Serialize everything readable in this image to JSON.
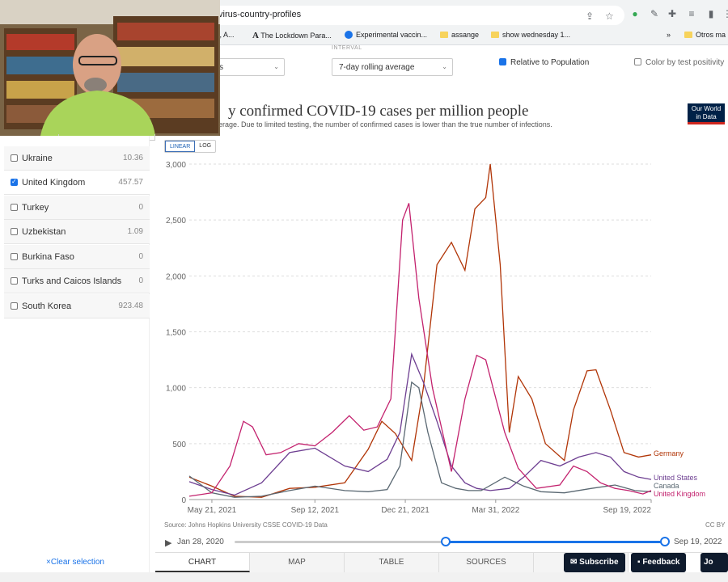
{
  "browser": {
    "url": "virus-country-profiles",
    "bookmarks": [
      "sh, A...",
      "The Lockdown Para...",
      "Experimental vaccin...",
      "assange",
      "show wednesday 1...",
      "»",
      "Otros ma"
    ]
  },
  "controls": {
    "metric_value": "s",
    "interval_label": "INTERVAL",
    "interval_value": "7-day rolling average",
    "relative_label": "Relative to Population",
    "relative_checked": true,
    "color_test_label": "Color by test positivity",
    "color_test_checked": false
  },
  "chart_header": {
    "title": "y confirmed COVID-19 cases per million people",
    "subtitle": "erage. Due to limited testing, the number of confirmed cases is lower than the true number of infections.",
    "logo_line1": "Our World",
    "logo_line2": "in Data",
    "scale_linear": "LINEAR",
    "scale_log": "LOG"
  },
  "sidebar": {
    "countries": [
      {
        "name": "Ukraine",
        "value": "10.36",
        "checked": false
      },
      {
        "name": "United Kingdom",
        "value": "457.57",
        "checked": true
      },
      {
        "name": "Turkey",
        "value": "0",
        "checked": false
      },
      {
        "name": "Uzbekistan",
        "value": "1.09",
        "checked": false
      },
      {
        "name": "Burkina Faso",
        "value": "0",
        "checked": false
      },
      {
        "name": "Turks and Caicos Islands",
        "value": "0",
        "checked": false
      },
      {
        "name": "South Korea",
        "value": "923.48",
        "checked": false
      }
    ],
    "clear_label": "Clear selection"
  },
  "chart_data": {
    "type": "line",
    "x_ticks": [
      "May 21, 2021",
      "Sep 12, 2021",
      "Dec 21, 2021",
      "Mar 31, 2022",
      "Sep 19, 2022"
    ],
    "y_ticks": [
      "0",
      "500",
      "1,000",
      "1,500",
      "2,000",
      "2,500",
      "3,000"
    ],
    "ylim": [
      0,
      3000
    ],
    "xlim": [
      "2021-04-26",
      "2022-09-19"
    ],
    "series": [
      {
        "name": "Germany",
        "color": "#b13507",
        "dates": [
          "2021-04-26",
          "2021-05-21",
          "2021-06-15",
          "2021-07-15",
          "2021-08-15",
          "2021-09-12",
          "2021-10-15",
          "2021-11-10",
          "2021-11-25",
          "2021-12-10",
          "2021-12-28",
          "2022-01-10",
          "2022-01-25",
          "2022-02-10",
          "2022-02-25",
          "2022-03-08",
          "2022-03-20",
          "2022-03-25",
          "2022-04-05",
          "2022-04-15",
          "2022-04-25",
          "2022-05-10",
          "2022-05-25",
          "2022-06-15",
          "2022-06-25",
          "2022-07-10",
          "2022-07-20",
          "2022-08-05",
          "2022-08-20",
          "2022-09-05",
          "2022-09-19"
        ],
        "values": [
          200,
          120,
          30,
          20,
          100,
          110,
          150,
          450,
          700,
          590,
          350,
          1000,
          2100,
          2300,
          2050,
          2600,
          2700,
          3000,
          2100,
          600,
          1100,
          900,
          500,
          350,
          800,
          1150,
          1160,
          800,
          420,
          380,
          400
        ]
      },
      {
        "name": "United States",
        "color": "#6d3e91",
        "dates": [
          "2021-04-26",
          "2021-05-21",
          "2021-06-15",
          "2021-07-15",
          "2021-08-15",
          "2021-09-12",
          "2021-10-15",
          "2021-11-10",
          "2021-12-01",
          "2021-12-15",
          "2021-12-28",
          "2022-01-10",
          "2022-01-25",
          "2022-02-10",
          "2022-02-25",
          "2022-03-10",
          "2022-03-25",
          "2022-04-15",
          "2022-05-01",
          "2022-05-20",
          "2022-06-10",
          "2022-07-01",
          "2022-07-20",
          "2022-08-05",
          "2022-08-20",
          "2022-09-05",
          "2022-09-19"
        ],
        "values": [
          160,
          90,
          40,
          150,
          420,
          460,
          300,
          250,
          360,
          600,
          1300,
          1050,
          700,
          300,
          150,
          100,
          80,
          100,
          200,
          350,
          300,
          380,
          420,
          380,
          250,
          200,
          180
        ]
      },
      {
        "name": "Canada",
        "color": "#5a6872",
        "dates": [
          "2021-04-26",
          "2021-05-21",
          "2021-06-15",
          "2021-07-15",
          "2021-08-15",
          "2021-09-12",
          "2021-10-15",
          "2021-11-10",
          "2021-12-01",
          "2021-12-15",
          "2021-12-28",
          "2022-01-05",
          "2022-01-15",
          "2022-01-30",
          "2022-02-15",
          "2022-03-01",
          "2022-03-15",
          "2022-04-10",
          "2022-05-01",
          "2022-05-20",
          "2022-06-15",
          "2022-07-15",
          "2022-08-10",
          "2022-09-01",
          "2022-09-19"
        ],
        "values": [
          210,
          60,
          20,
          30,
          80,
          120,
          80,
          70,
          90,
          300,
          1050,
          1000,
          600,
          150,
          100,
          80,
          80,
          200,
          120,
          70,
          60,
          100,
          130,
          80,
          70
        ]
      },
      {
        "name": "United Kingdom",
        "color": "#c3226e",
        "dates": [
          "2021-04-26",
          "2021-05-21",
          "2021-06-10",
          "2021-06-25",
          "2021-07-05",
          "2021-07-20",
          "2021-08-05",
          "2021-08-25",
          "2021-09-12",
          "2021-10-01",
          "2021-10-20",
          "2021-11-05",
          "2021-11-20",
          "2021-12-05",
          "2021-12-18",
          "2021-12-25",
          "2022-01-05",
          "2022-01-20",
          "2022-02-10",
          "2022-02-25",
          "2022-03-10",
          "2022-03-20",
          "2022-03-28",
          "2022-04-10",
          "2022-04-25",
          "2022-05-15",
          "2022-06-10",
          "2022-06-25",
          "2022-07-10",
          "2022-07-25",
          "2022-08-10",
          "2022-08-25",
          "2022-09-10",
          "2022-09-19"
        ],
        "values": [
          30,
          60,
          300,
          700,
          650,
          400,
          420,
          500,
          480,
          600,
          750,
          620,
          650,
          900,
          2500,
          2650,
          1800,
          1000,
          250,
          900,
          1290,
          1250,
          1000,
          600,
          280,
          100,
          130,
          300,
          250,
          150,
          100,
          80,
          50,
          80
        ]
      }
    ]
  },
  "footer": {
    "source": "Source: Johns Hopkins University CSSE COVID-19 Data",
    "license": "CC BY",
    "timeline_start": "Jan 28, 2020",
    "timeline_end": "Sep 19, 2022",
    "timeline_range_start": 0.49,
    "timeline_range_end": 1.0,
    "tabs": [
      "CHART",
      "MAP",
      "TABLE",
      "SOURCES",
      ""
    ],
    "subscribe": "Subscribe",
    "feedback": "Feedback",
    "join": "Jo"
  }
}
